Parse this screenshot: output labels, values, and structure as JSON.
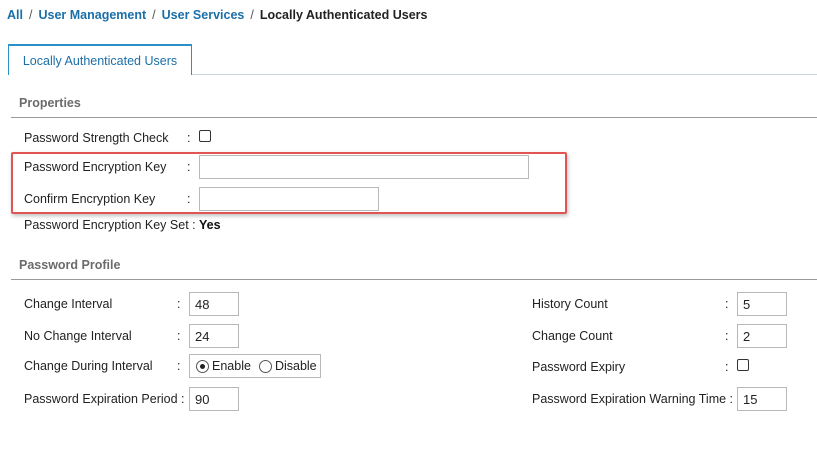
{
  "breadcrumb": {
    "items": [
      "All",
      "User Management",
      "User Services"
    ],
    "current": "Locally Authenticated Users",
    "separator": "/"
  },
  "tab": {
    "label": "Locally Authenticated Users"
  },
  "properties": {
    "title": "Properties",
    "password_strength_check": {
      "label": "Password Strength Check",
      "checked": false
    },
    "password_encryption_key": {
      "label": "Password Encryption Key",
      "value": ""
    },
    "confirm_encryption_key": {
      "label": "Confirm Encryption Key",
      "value": ""
    },
    "encryption_key_set": {
      "label": "Password Encryption Key Set",
      "value": "Yes"
    }
  },
  "password_profile": {
    "title": "Password Profile",
    "change_interval": {
      "label": "Change Interval",
      "value": "48"
    },
    "no_change_interval": {
      "label": "No Change Interval",
      "value": "24"
    },
    "change_during_interval": {
      "label": "Change During Interval",
      "options": [
        "Enable",
        "Disable"
      ],
      "selected": "Enable"
    },
    "password_expiration_period": {
      "label": "Password Expiration Period",
      "value": "90"
    },
    "history_count": {
      "label": "History Count",
      "value": "5"
    },
    "change_count": {
      "label": "Change Count",
      "value": "2"
    },
    "password_expiry": {
      "label": "Password Expiry",
      "checked": false
    },
    "password_expiration_warning_time": {
      "label": "Password Expiration Warning Time",
      "value": "15"
    }
  },
  "colors": {
    "link": "#1b6fa8",
    "tab_border": "#2b8fc8",
    "highlight": "#e25353"
  }
}
